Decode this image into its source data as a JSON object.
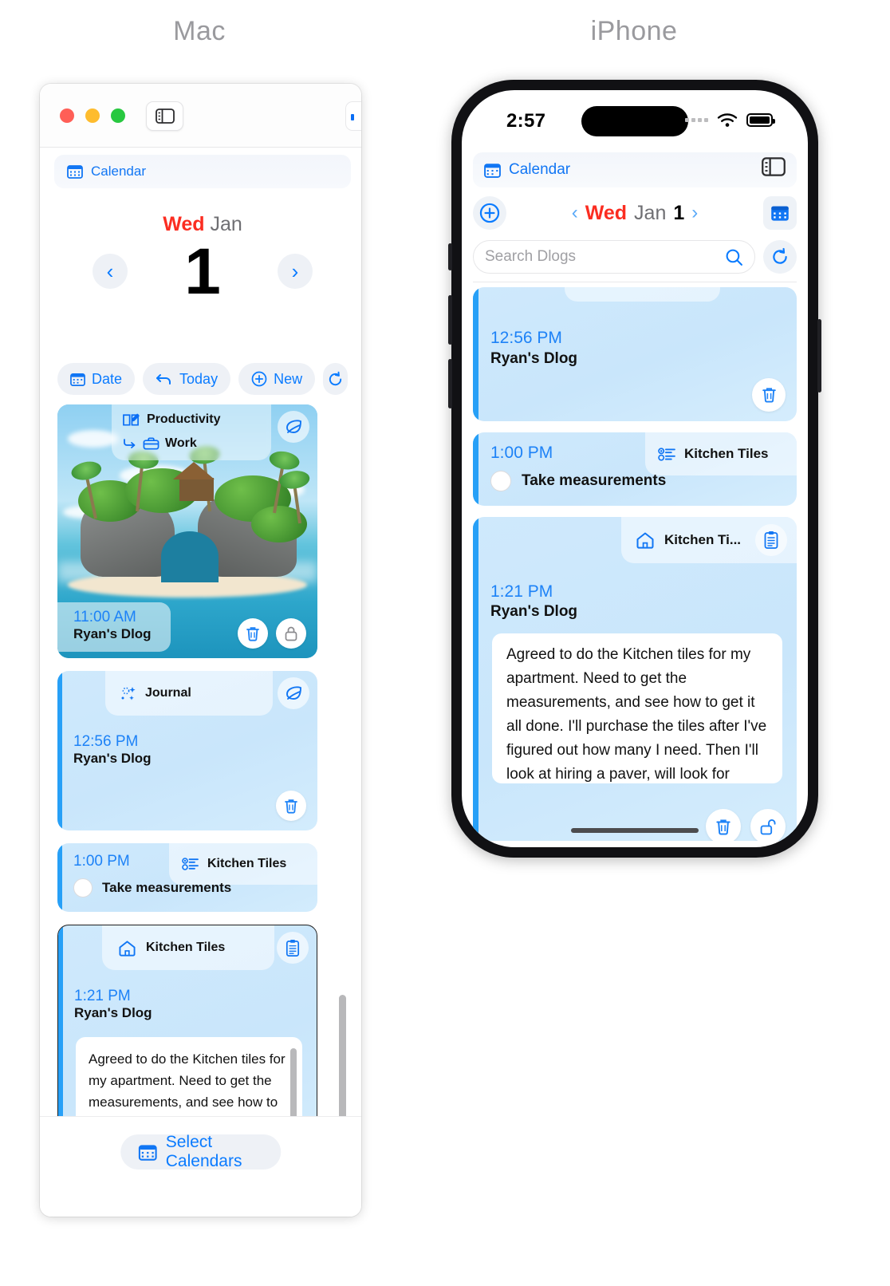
{
  "captions": {
    "mac": "Mac",
    "iphone": "iPhone"
  },
  "colors": {
    "accent_blue": "#0a7bff",
    "link_blue": "#1176f4",
    "day_red": "#fb2d21",
    "card_blue": "#cfe9fc",
    "stripe_blue": "#27a0f7"
  },
  "mac": {
    "calendar_label": "Calendar",
    "date": {
      "weekday": "Wed",
      "month": "Jan",
      "day": "1"
    },
    "toolbar": {
      "date_label": "Date",
      "today_label": "Today",
      "new_label": "New",
      "refresh_label": ""
    },
    "cards": [
      {
        "type": "image-event",
        "category": "Productivity",
        "subcategory": "Work",
        "time": "11:00 AM",
        "title": "Ryan's Dlog"
      },
      {
        "type": "event",
        "category": "Journal",
        "time": "12:56 PM",
        "title": "Ryan's Dlog"
      },
      {
        "type": "task",
        "category": "Kitchen Tiles",
        "time": "1:00 PM",
        "task": "Take measurements"
      },
      {
        "type": "note",
        "category": "Kitchen Tiles",
        "time": "1:21 PM",
        "title": "Ryan's Dlog",
        "note": "Agreed to do the Kitchen tiles for my apartment. Need to get the measurements, and see how to get it all done. I'll purchase the tiles after I've"
      }
    ],
    "footer": {
      "select_calendars_label": "Select Calendars"
    }
  },
  "iphone": {
    "status": {
      "time": "2:57"
    },
    "calendar_label": "Calendar",
    "date": {
      "weekday": "Wed",
      "month": "Jan",
      "day": "1"
    },
    "search": {
      "placeholder": "Search Dlogs",
      "value": ""
    },
    "cards": [
      {
        "type": "event",
        "time": "12:56 PM",
        "title": "Ryan's Dlog"
      },
      {
        "type": "task",
        "category": "Kitchen Tiles",
        "time": "1:00 PM",
        "task": "Take measurements"
      },
      {
        "type": "note",
        "category": "Kitchen Ti...",
        "time": "1:21 PM",
        "title": "Ryan's Dlog",
        "note": "Agreed to do the Kitchen tiles for my apartment. Need to get the measurements, and see how to get it all done. I'll purchase the tiles after I've figured out how many I need. Then I'll look at hiring a paver, will look for adverts at the"
      }
    ]
  }
}
